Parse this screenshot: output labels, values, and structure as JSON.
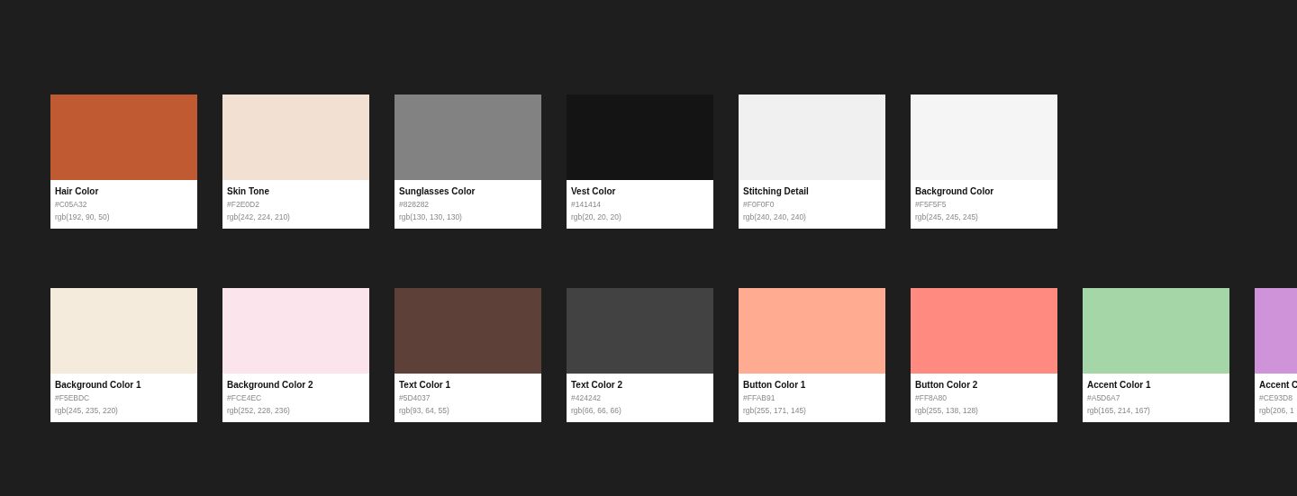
{
  "rows": [
    {
      "swatches": [
        {
          "name": "Hair Color",
          "hex": "#C05A32",
          "rgb": "rgb(192, 90, 50)",
          "color": "#c05a32"
        },
        {
          "name": "Skin Tone",
          "hex": "#F2E0D2",
          "rgb": "rgb(242, 224, 210)",
          "color": "#f2e0d2"
        },
        {
          "name": "Sunglasses Color",
          "hex": "#828282",
          "rgb": "rgb(130, 130, 130)",
          "color": "#828282"
        },
        {
          "name": "Vest Color",
          "hex": "#141414",
          "rgb": "rgb(20, 20, 20)",
          "color": "#141414"
        },
        {
          "name": "Stitching Detail",
          "hex": "#F0F0F0",
          "rgb": "rgb(240, 240, 240)",
          "color": "#f0f0f0"
        },
        {
          "name": "Background Color",
          "hex": "#F5F5F5",
          "rgb": "rgb(245, 245, 245)",
          "color": "#f5f5f5"
        }
      ]
    },
    {
      "swatches": [
        {
          "name": "Background Color 1",
          "hex": "#F5EBDC",
          "rgb": "rgb(245, 235, 220)",
          "color": "#f5ebdc"
        },
        {
          "name": "Background Color 2",
          "hex": "#FCE4EC",
          "rgb": "rgb(252, 228, 236)",
          "color": "#fce4ec"
        },
        {
          "name": "Text Color 1",
          "hex": "#5D4037",
          "rgb": "rgb(93, 64, 55)",
          "color": "#5d4037"
        },
        {
          "name": "Text Color 2",
          "hex": "#424242",
          "rgb": "rgb(66, 66, 66)",
          "color": "#424242"
        },
        {
          "name": "Button Color 1",
          "hex": "#FFAB91",
          "rgb": "rgb(255, 171, 145)",
          "color": "#ffab91"
        },
        {
          "name": "Button Color 2",
          "hex": "#FF8A80",
          "rgb": "rgb(255, 138, 128)",
          "color": "#ff8a80"
        },
        {
          "name": "Accent Color 1",
          "hex": "#A5D6A7",
          "rgb": "rgb(165, 214, 167)",
          "color": "#a5d6a7"
        },
        {
          "name": "Accent C",
          "hex": "#CE93D8",
          "rgb": "rgb(206, 1",
          "color": "#ce93d8"
        }
      ]
    }
  ]
}
